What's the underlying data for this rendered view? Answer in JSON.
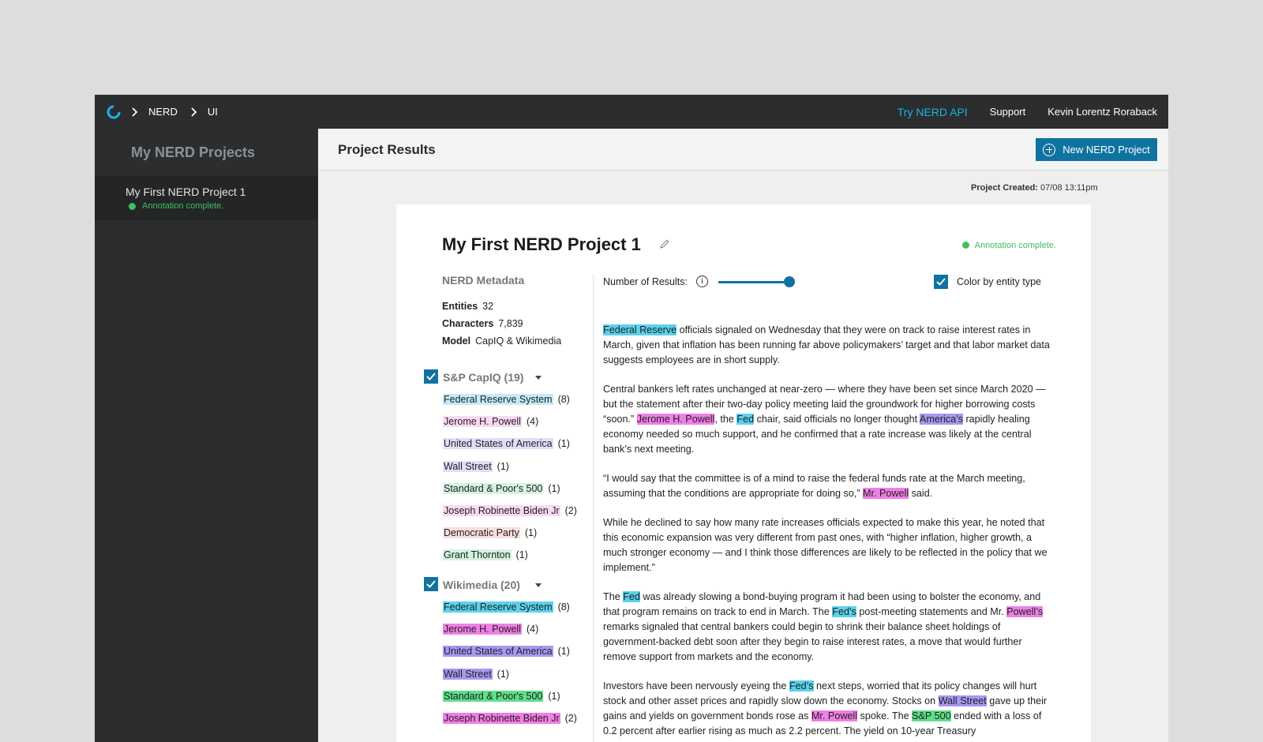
{
  "breadcrumb": [
    "NERD",
    "UI"
  ],
  "topnav": {
    "api": "Try NERD API",
    "support": "Support",
    "user": "Kevin Lorentz Roraback"
  },
  "sidebar": {
    "title": "My NERD Projects",
    "items": [
      {
        "label": "My First NERD Project 1",
        "status": "Annotation complete."
      }
    ]
  },
  "main": {
    "title": "Project Results",
    "new_button": "New NERD Project"
  },
  "created": {
    "label": "Project Created:",
    "value": "07/08 13:11pm"
  },
  "project": {
    "title": "My First NERD Project 1",
    "status": "Annotation complete."
  },
  "metadata": {
    "heading": "NERD Metadata",
    "rows": [
      {
        "label": "Entities",
        "value": "32"
      },
      {
        "label": "Characters",
        "value": "7,839"
      },
      {
        "label": "Model",
        "value": "CapIQ & Wikimedia"
      }
    ]
  },
  "groups": [
    {
      "label": "S&P CapIQ (19)",
      "entities": [
        {
          "name": "Federal Reserve System",
          "count": "(8)",
          "type": "org"
        },
        {
          "name": "Jerome H. Powell",
          "count": "(4)",
          "type": "per"
        },
        {
          "name": "United States of America",
          "count": "(1)",
          "type": "loc"
        },
        {
          "name": "Wall Street",
          "count": "(1)",
          "type": "loc"
        },
        {
          "name": "Standard & Poor's 500",
          "count": "(1)",
          "type": "idx"
        },
        {
          "name": "Joseph Robinette Biden Jr",
          "count": "(2)",
          "type": "per"
        },
        {
          "name": "Democratic Party",
          "count": "(1)",
          "type": "par"
        },
        {
          "name": "Grant Thornton",
          "count": "(1)",
          "type": "idx"
        }
      ]
    },
    {
      "label": "Wikimedia (20)",
      "entities": [
        {
          "name": "Federal Reserve System",
          "count": "(8)",
          "type": "org"
        },
        {
          "name": "Jerome H. Powell",
          "count": "(4)",
          "type": "per"
        },
        {
          "name": "United States of America",
          "count": "(1)",
          "type": "loc"
        },
        {
          "name": "Wall Street",
          "count": "(1)",
          "type": "loc"
        },
        {
          "name": "Standard & Poor's 500",
          "count": "(1)",
          "type": "idx"
        },
        {
          "name": "Joseph Robinette Biden Jr",
          "count": "(2)",
          "type": "per"
        }
      ]
    }
  ],
  "controls": {
    "results_label": "Number of Results:",
    "results_level": 1.0,
    "color_by_entity": "Color by entity type"
  },
  "paragraphs": [
    [
      {
        "t": "Federal Reserve",
        "e": "org"
      },
      {
        "t": " officials signaled on Wednesday that they were on track to raise interest rates in March, given that inflation has been running far above policymakers’ target and that labor market data suggests employees are in short supply."
      }
    ],
    [
      {
        "t": "Central bankers left rates unchanged at near-zero — where they have been set since March 2020 — but the statement after their two-day policy meeting laid the groundwork for higher borrowing costs “soon.” "
      },
      {
        "t": "Jerome H. Powell",
        "e": "per"
      },
      {
        "t": ", the "
      },
      {
        "t": "Fed",
        "e": "org"
      },
      {
        "t": " chair, said officials no longer thought "
      },
      {
        "t": "America’s",
        "e": "loc"
      },
      {
        "t": " rapidly healing economy needed so much support, and he confirmed that a rate increase was likely at the central bank’s next meeting."
      }
    ],
    [
      {
        "t": "“I would say that the committee is of a mind to raise the federal funds rate at the March meeting, assuming that the conditions are appropriate for doing so,” "
      },
      {
        "t": "Mr. Powell",
        "e": "per"
      },
      {
        "t": " said."
      }
    ],
    [
      {
        "t": "While he declined to say how many rate increases officials expected to make this year, he noted that this economic expansion was very different from past ones, with “higher inflation, higher growth, a much stronger economy — and I think those differences are likely to be reflected in the policy that we implement.”"
      }
    ],
    [
      {
        "t": "The "
      },
      {
        "t": "Fed",
        "e": "org"
      },
      {
        "t": " was already slowing a bond-buying program it had been using to bolster the economy, and that program remains on track to end in March. The "
      },
      {
        "t": "Fed’s",
        "e": "org"
      },
      {
        "t": " post-meeting statements and Mr. "
      },
      {
        "t": "Powell’s",
        "e": "per"
      },
      {
        "t": " remarks signaled that central bankers could begin to shrink their balance sheet holdings of government-backed debt soon after they begin to raise interest rates, a move that would further remove support from markets and the economy."
      }
    ],
    [
      {
        "t": "Investors have been nervously eyeing the "
      },
      {
        "t": "Fed’s",
        "e": "org"
      },
      {
        "t": " next steps, worried that its policy changes will hurt stock and other asset prices and rapidly slow down the economy. Stocks on "
      },
      {
        "t": "Wall Street",
        "e": "loc"
      },
      {
        "t": " gave up their gains and yields on government bonds rose as "
      },
      {
        "t": "Mr. Powell",
        "e": "per"
      },
      {
        "t": " spoke. The "
      },
      {
        "t": "S&P 500",
        "e": "idx"
      },
      {
        "t": " ended with a loss of 0.2 percent after earlier rising as much as 2.2 percent. The yield on 10-year Treasury"
      }
    ]
  ]
}
